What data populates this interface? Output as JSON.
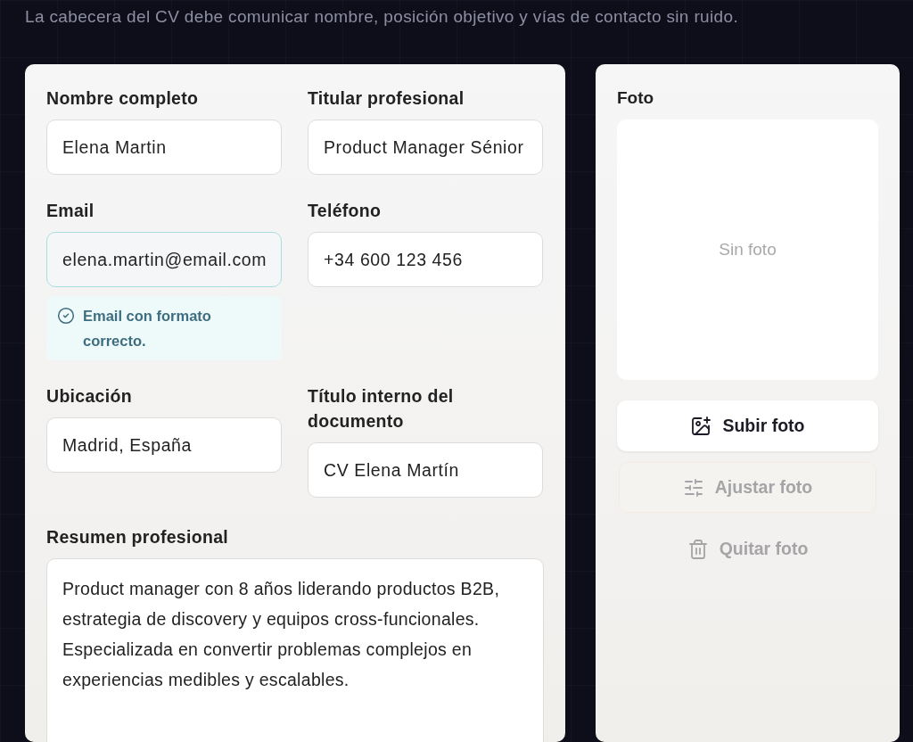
{
  "intro": "La cabecera del CV debe comunicar nombre, posición objetivo y vías de contacto sin ruido.",
  "fields": [
    {
      "label": "Nombre completo",
      "value": "Elena Martin",
      "valid": false
    },
    {
      "label": "Titular profesional",
      "value": "Product Manager Sénior",
      "valid": false
    },
    {
      "label": "Email",
      "value": "elena.martin@email.com",
      "valid": true,
      "hint": "Email con formato correcto."
    },
    {
      "label": "Teléfono",
      "value": "+34 600 123 456",
      "valid": false
    },
    {
      "label": "Ubicación",
      "value": "Madrid, España",
      "valid": false
    },
    {
      "label": "Título interno del documento",
      "value": "CV Elena Martín",
      "valid": false
    }
  ],
  "summary": {
    "label": "Resumen profesional",
    "value": "Product manager con 8 años liderando productos B2B, estrategia de discovery y equipos cross-funcionales. Especializada en convertir problemas complejos en experiencias medibles y escalables."
  },
  "photo": {
    "label": "Foto",
    "placeholder": "Sin foto",
    "buttons": [
      {
        "label": "Subir foto",
        "kind": "primary",
        "disabled": false
      },
      {
        "label": "Ajustar foto",
        "kind": "secondary",
        "disabled": true
      },
      {
        "label": "Quitar foto",
        "kind": "ghost",
        "disabled": true
      }
    ]
  }
}
